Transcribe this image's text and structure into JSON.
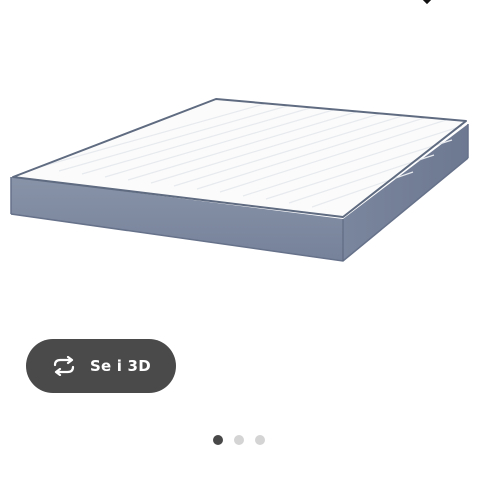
{
  "product_image": {
    "icon": "mattress-image",
    "colors": {
      "top": "#fbfbfb",
      "quilt_line": "#e9ecef",
      "side": "#7f8ba1",
      "piping": "#5f6b80"
    }
  },
  "view_3d_button": {
    "label": "Se i 3D",
    "icon": "rotate-3d-icon",
    "background": "#4a4a4a"
  },
  "carousel": {
    "page_count": 3,
    "active_index": 0
  }
}
